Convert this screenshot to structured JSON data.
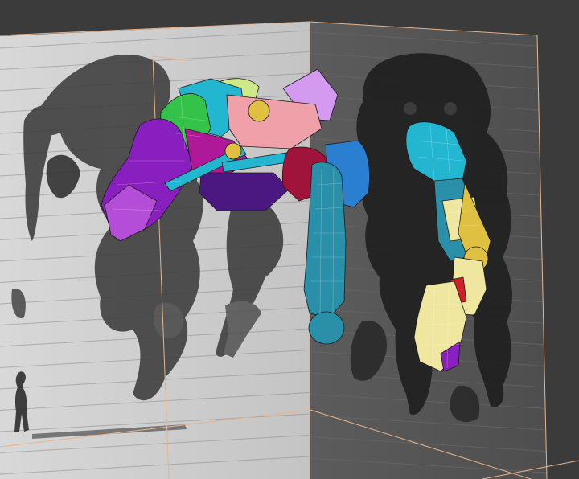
{
  "viewport": {
    "background": "#3b3b3b",
    "front_plane_color": "#cfcfcf",
    "side_plane_color": "#585858",
    "guide_line_color": "#e8b48c",
    "scanline_color": "#8a8a8a",
    "reference_ink_dark": "#3a3a3a",
    "reference_ink_side": "#1e1e1e"
  },
  "model": {
    "part_colors": {
      "purple": "#8a1fc0",
      "magenta": "#b0189a",
      "green": "#34c24a",
      "yellow_green": "#cfe88a",
      "cyan": "#22b6d0",
      "teal": "#2a8fa8",
      "pink": "#f0a0a8",
      "lavender": "#d39af0",
      "crimson": "#a0133a",
      "dark_violet": "#4a1880",
      "pale_yellow": "#efe7a0",
      "orange_yellow": "#e0c040",
      "blue": "#2a7fd0",
      "red": "#d0202a"
    }
  }
}
